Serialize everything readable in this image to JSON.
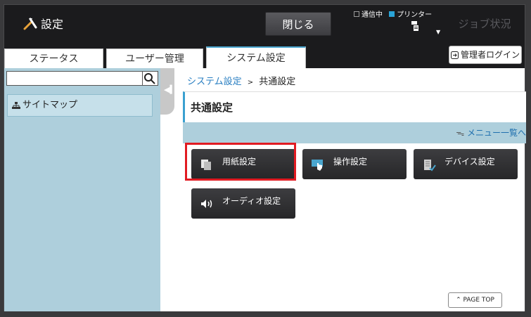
{
  "header": {
    "title": "設定",
    "close_label": "閉じる",
    "status_comm": "通信中",
    "status_printer": "プリンター",
    "job_status_label": "ジョブ状況"
  },
  "tabs": [
    {
      "label": "ステータス",
      "active": false
    },
    {
      "label": "ユーザー管理",
      "active": false
    },
    {
      "label": "システム設定",
      "active": true
    }
  ],
  "admin_login_label": "管理者ログイン",
  "sidebar": {
    "search_placeholder": "",
    "sitemap_label": "サイトマップ"
  },
  "breadcrumb": {
    "parent": "システム設定",
    "separator": ">",
    "current": "共通設定"
  },
  "section": {
    "title": "共通設定",
    "menu_link": "メニュー一覧へ"
  },
  "tiles": [
    {
      "label": "用紙設定",
      "icon": "paper-icon",
      "highlighted": true
    },
    {
      "label": "操作設定",
      "icon": "touch-icon",
      "highlighted": false
    },
    {
      "label": "デバイス設定",
      "icon": "device-icon",
      "highlighted": false
    },
    {
      "label": "オーディオ設定",
      "icon": "speaker-icon",
      "highlighted": false
    }
  ],
  "page_top_label": "PAGE TOP",
  "colors": {
    "accent": "#2aa3d6",
    "highlight": "#e11b22",
    "sidebar": "#aecfdc",
    "dark": "#1b1b1d"
  }
}
